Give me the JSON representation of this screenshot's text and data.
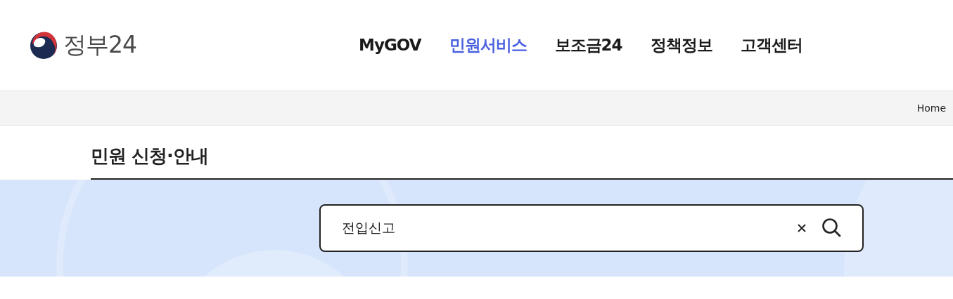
{
  "header": {
    "logo_text": "정부24",
    "nav": [
      {
        "label": "MyGOV",
        "selected": false
      },
      {
        "label": "민원서비스",
        "selected": true
      },
      {
        "label": "보조금24",
        "selected": false
      },
      {
        "label": "정책정보",
        "selected": false
      },
      {
        "label": "고객센터",
        "selected": false
      }
    ]
  },
  "breadcrumb": [
    "Home"
  ],
  "page_title": "민원 신청·안내",
  "search": {
    "value": "전입신고"
  }
}
